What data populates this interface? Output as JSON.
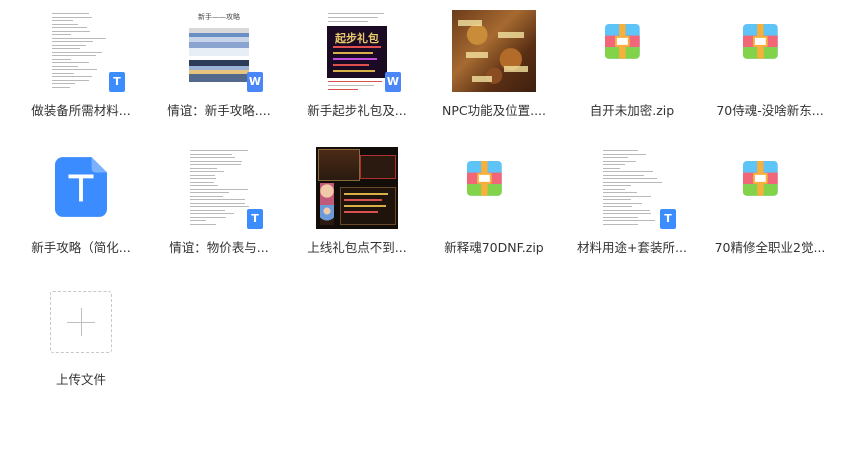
{
  "files": [
    {
      "name": "做装备所需材料...",
      "kind": "doc-text",
      "badge": "T",
      "badge_color": "#3b8cff"
    },
    {
      "name": "情谊：新手攻略....",
      "kind": "doc-screens",
      "badge": "W",
      "badge_color": "#4a86f7",
      "preview_title": "新手——攻略"
    },
    {
      "name": "新手起步礼包及...",
      "kind": "art-purple",
      "badge": "W",
      "badge_color": "#4a86f7",
      "preview_title": "起步礼包"
    },
    {
      "name": "NPC功能及位置....",
      "kind": "art-map"
    },
    {
      "name": "自开未加密.zip",
      "kind": "zip"
    },
    {
      "name": "70侍魂-没啥新东...",
      "kind": "zip"
    },
    {
      "name": "新手攻略（简化...",
      "kind": "txt-big",
      "badge": "T"
    },
    {
      "name": "情谊：物价表与...",
      "kind": "doc-text",
      "badge": "T",
      "badge_color": "#3b8cff"
    },
    {
      "name": "上线礼包点不到...",
      "kind": "art-dark"
    },
    {
      "name": "新释魂70DNF.zip",
      "kind": "zip"
    },
    {
      "name": "材料用途+套装所...",
      "kind": "doc-text",
      "badge": "T",
      "badge_color": "#3b8cff"
    },
    {
      "name": "70精修全职业2觉...",
      "kind": "zip"
    }
  ],
  "upload": {
    "label": "上传文件"
  },
  "colors": {
    "zip_top": "#5ec4f7",
    "zip_mid": "#f2667a",
    "zip_bottom": "#83d34a",
    "zip_strap": "#f7b03c",
    "txt_blue": "#3b8cff"
  }
}
